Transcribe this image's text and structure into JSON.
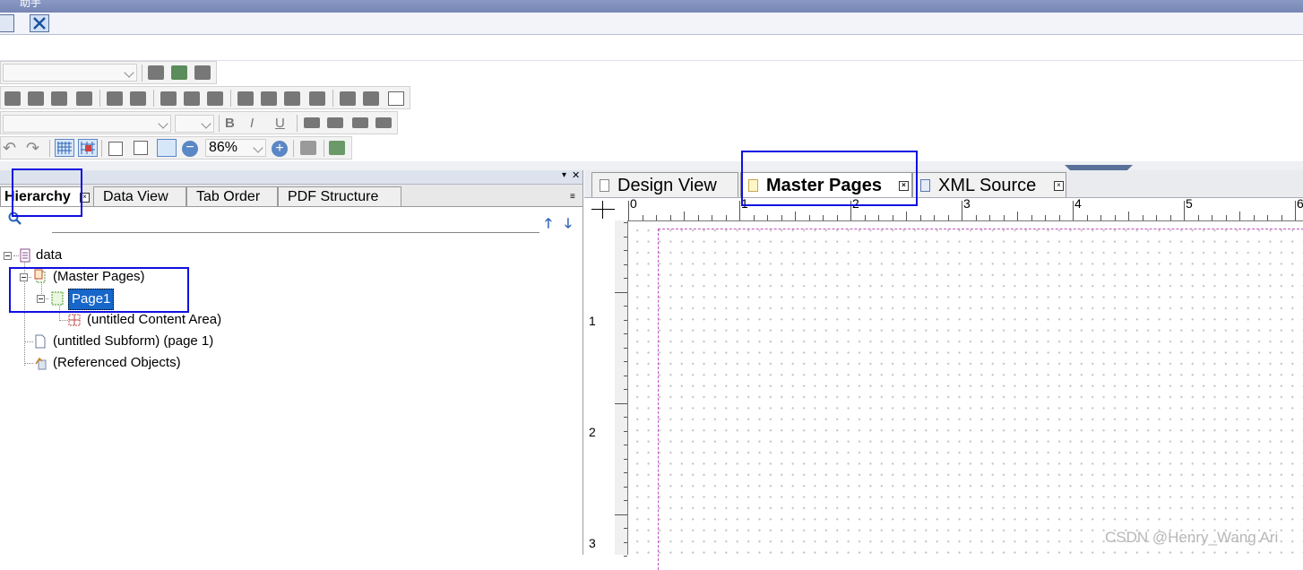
{
  "window": {
    "title": "助手"
  },
  "toolbar": {
    "zoom_value": "86%"
  },
  "left_panel": {
    "tabs": [
      {
        "label": "Hierarchy",
        "active": true
      },
      {
        "label": "Data View",
        "active": false
      },
      {
        "label": "Tab Order",
        "active": false
      },
      {
        "label": "PDF Structure",
        "active": false
      }
    ],
    "tree": [
      {
        "label": "data",
        "icon": "data-icon"
      },
      {
        "label": "(Master Pages)",
        "icon": "master-pages-icon"
      },
      {
        "label": "Page1",
        "icon": "page-icon",
        "selected": true
      },
      {
        "label": "(untitled Content Area)",
        "icon": "content-area-icon"
      },
      {
        "label": "(untitled Subform) (page 1)",
        "icon": "subform-icon"
      },
      {
        "label": "(Referenced Objects)",
        "icon": "referenced-objects-icon"
      }
    ]
  },
  "right_panel": {
    "tabs": [
      {
        "label": "Design View",
        "active": false
      },
      {
        "label": "Master Pages",
        "active": true
      },
      {
        "label": "XML Source",
        "active": false
      }
    ],
    "ruler_h": [
      "0",
      "1",
      "2",
      "3",
      "4",
      "5",
      "6"
    ],
    "ruler_v": [
      "1",
      "2",
      "3"
    ]
  },
  "watermark": "CSDN @Henry_Wang Ari",
  "colors": {
    "highlight": "#1010e0",
    "selection": "#1766c9",
    "margin_guide": "#c050c0"
  }
}
